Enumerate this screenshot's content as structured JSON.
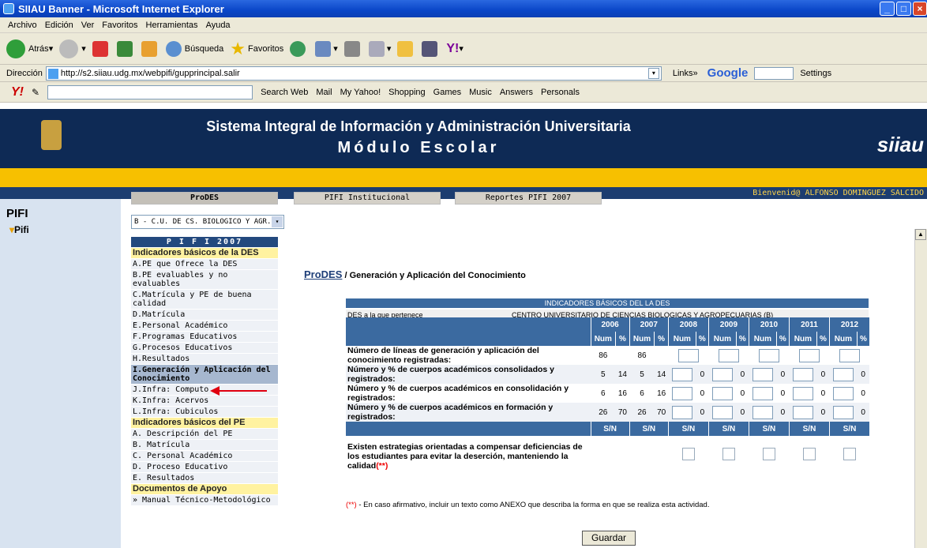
{
  "window": {
    "title": "SIIAU Banner - Microsoft Internet Explorer"
  },
  "menu": [
    "Archivo",
    "Edición",
    "Ver",
    "Favoritos",
    "Herramientas",
    "Ayuda"
  ],
  "toolbar": {
    "back": "Atrás",
    "search": "Búsqueda",
    "favorites": "Favoritos"
  },
  "address": {
    "label": "Dirección",
    "url": "http://s2.siiau.udg.mx/webpifi/gupprincipal.salir",
    "links": "Links",
    "google": "Google",
    "settings": "Settings"
  },
  "yahoo": {
    "items": [
      "Search Web",
      "Mail",
      "My Yahoo!",
      "Shopping",
      "Games",
      "Music",
      "Answers",
      "Personals"
    ]
  },
  "banner": {
    "title": "Sistema Integral de Información y Administración Universitaria",
    "subtitle": "Módulo Escolar",
    "logo": "siiau"
  },
  "welcome": "Bienvenid@ ALFONSO DOMINGUEZ SALCIDO",
  "sidebar": {
    "title": "PIFI",
    "item": "Pifi"
  },
  "tabs": {
    "prodes": "ProDES",
    "institucional": "PIFI Institucional",
    "reportes": "Reportes PIFI 2007"
  },
  "select_value": "B - C.U. DE CS. BIOLOGICO Y AGR.",
  "left_menu": [
    {
      "t": "P I F I   2007",
      "k": "blue"
    },
    {
      "t": "Indicadores básicos de la DES",
      "k": "head"
    },
    {
      "t": "A.PE que Ofrece la DES",
      "k": ""
    },
    {
      "t": "B.PE evaluables y no evaluables",
      "k": ""
    },
    {
      "t": "C.Matrícula y PE de buena calidad",
      "k": ""
    },
    {
      "t": "D.Matrícula",
      "k": ""
    },
    {
      "t": "E.Personal Académico",
      "k": ""
    },
    {
      "t": "F.Programas Educativos",
      "k": ""
    },
    {
      "t": "G.Procesos Educativos",
      "k": ""
    },
    {
      "t": "H.Resultados",
      "k": ""
    },
    {
      "t": "I.Generación y Aplicación del Conocimiento",
      "k": "sel"
    },
    {
      "t": "J.Infra: Computo",
      "k": ""
    },
    {
      "t": "K.Infra: Acervos",
      "k": ""
    },
    {
      "t": "L.Infra: Cubiculos",
      "k": ""
    },
    {
      "t": "Indicadores básicos del PE",
      "k": "head"
    },
    {
      "t": "A. Descripción del PE",
      "k": ""
    },
    {
      "t": "B. Matrícula",
      "k": ""
    },
    {
      "t": "C. Personal Académico",
      "k": ""
    },
    {
      "t": "D. Proceso Educativo",
      "k": ""
    },
    {
      "t": "E. Resultados",
      "k": ""
    },
    {
      "t": "Documentos de Apoyo",
      "k": "head"
    },
    {
      "t": "» Manual Técnico-Metodológico",
      "k": ""
    }
  ],
  "breadcrumb": {
    "link": "ProDES",
    "rest": " / Generación y Aplicación del Conocimiento"
  },
  "des": {
    "header": "INDICADORES BÁSICOS DEL LA DES",
    "label": "DES a la que pertenece",
    "value": "CENTRO UNIVERSITARIO DE CIENCIAS BIOLOGICAS Y AGROPECUARIAS (B)"
  },
  "years": [
    "2006",
    "2007",
    "2008",
    "2009",
    "2010",
    "2011",
    "2012"
  ],
  "subhdr": {
    "num": "Num",
    "pct": "%",
    "sn": "S/N"
  },
  "rows": [
    {
      "label": "Número de líneas de generación y aplicación del conocimiento registradas:",
      "v2006": "86",
      "v2007": "86",
      "pct": false
    },
    {
      "label": "Número y % de cuerpos académicos consolidados y registrados:",
      "v2006": "5",
      "p2006": "14",
      "v2007": "5",
      "p2007": "14",
      "pct": true
    },
    {
      "label": "Número y % de cuerpos académicos en consolidación y registrados:",
      "v2006": "6",
      "p2006": "16",
      "v2007": "6",
      "p2007": "16",
      "pct": true
    },
    {
      "label": "Número y % de cuerpos académicos en formación y registrados:",
      "v2006": "26",
      "p2006": "70",
      "v2007": "26",
      "p2007": "70",
      "pct": true
    }
  ],
  "zero": "0",
  "strategy_label": "Existen estrategias orientadas a compensar deficiencias de los estudiantes para evitar la deserción, manteniendo la calidad",
  "mark": "(**)",
  "note": " - En caso afirmativo, incluir un texto como ANEXO que describa la forma en que se realiza esta actividad.",
  "save": "Guardar"
}
